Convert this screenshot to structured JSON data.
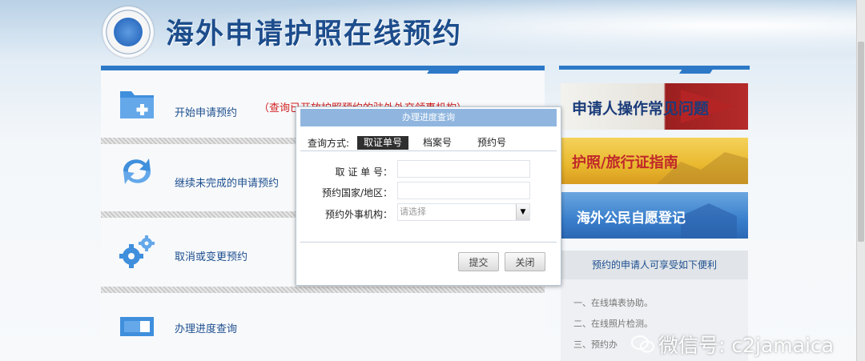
{
  "header": {
    "site_title": "海外申请护照在线预约",
    "emblem_icon": "consular-emblem-icon"
  },
  "menu": {
    "items": [
      {
        "label": "开始申请预约",
        "icon": "folder-add-icon"
      },
      {
        "label": "继续未完成的申请预约",
        "icon": "refresh-arrows-icon"
      },
      {
        "label": "取消或变更预约",
        "icon": "gears-icon"
      },
      {
        "label": "办理进度查询",
        "icon": "progress-window-icon"
      }
    ],
    "notice": "（查询已开放护照预约的驻外外交领事机构）"
  },
  "banners": [
    {
      "label": "申请人操作常见问题",
      "color": "#1b3c7a"
    },
    {
      "label": "护照/旅行证指南",
      "color": "#c0282a"
    },
    {
      "label": "海外公民自愿登记",
      "color": "#ffffff"
    }
  ],
  "benefits": {
    "title": "预约的申请人可享受如下便利",
    "items": [
      "一、在线填表协助。",
      "二、在线照片检测。",
      "三、预约办"
    ]
  },
  "modal": {
    "title": "办理进度查询",
    "query_label": "查询方式:",
    "tabs": [
      "取证单号",
      "档案号",
      "预约号"
    ],
    "active_tab": 0,
    "fields": {
      "receipt_label": "取 证 单 号：",
      "receipt_value": "",
      "country_label": "预约国家/地区：",
      "country_value": "",
      "agency_label": "预约外事机构：",
      "agency_value": "请选择"
    },
    "submit_label": "提交",
    "close_label": "关闭"
  },
  "watermark": {
    "text": "微信号: c2jamaica",
    "icon": "wechat-icon"
  },
  "colors": {
    "accent": "#2d79c8",
    "title_text": "#1d4d8c",
    "notice_red": "#d32222"
  }
}
